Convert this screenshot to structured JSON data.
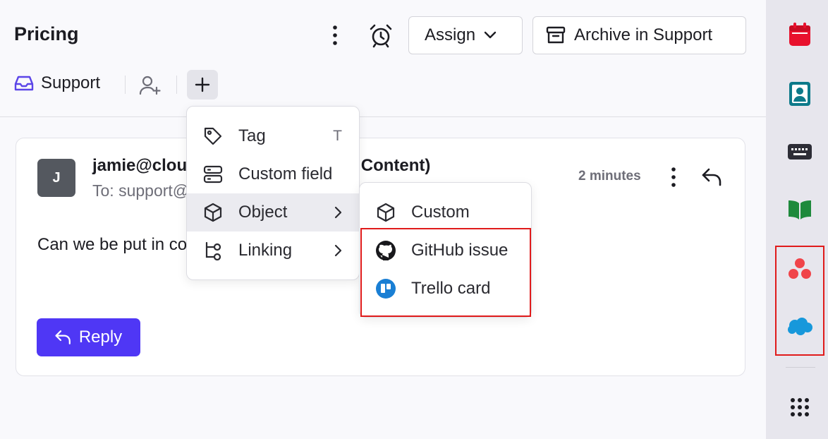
{
  "header": {
    "title": "Pricing",
    "assign_label": "Assign",
    "archive_label": "Archive in Support"
  },
  "subbar": {
    "inbox_label": "Support"
  },
  "message": {
    "avatar_initial": "J",
    "sender": "jamie@cloudcontent.com (Cloud Content)",
    "recipient": "To: support@example.com",
    "time": "2 minutes",
    "body": "Can we be put in contact with someone to discuss pricing?",
    "reply_label": "Reply"
  },
  "add_menu": {
    "items": [
      {
        "label": "Tag",
        "hint": "T",
        "icon": "tag-icon"
      },
      {
        "label": "Custom field",
        "icon": "custom-field-icon"
      },
      {
        "label": "Object",
        "icon": "cube-icon",
        "submenu": true
      },
      {
        "label": "Linking",
        "icon": "linking-icon",
        "submenu": true
      }
    ]
  },
  "object_submenu": {
    "items": [
      {
        "label": "Custom",
        "icon": "cube-icon"
      },
      {
        "label": "GitHub issue",
        "icon": "github-icon"
      },
      {
        "label": "Trello card",
        "icon": "trello-icon"
      }
    ]
  },
  "rail": {
    "icons": [
      "calendar-icon",
      "contacts-icon",
      "keyboard-icon",
      "book-icon",
      "asana-icon",
      "salesforce-icon",
      "apps-grid-icon"
    ]
  },
  "colors": {
    "accent": "#4f37f5",
    "highlight": "#e01b1b",
    "calendar": "#e8112d",
    "contacts": "#0d7a8a",
    "book": "#1e8a3c",
    "asana": "#f0444a",
    "salesforce": "#1798db",
    "trello": "#1a7fd4"
  }
}
